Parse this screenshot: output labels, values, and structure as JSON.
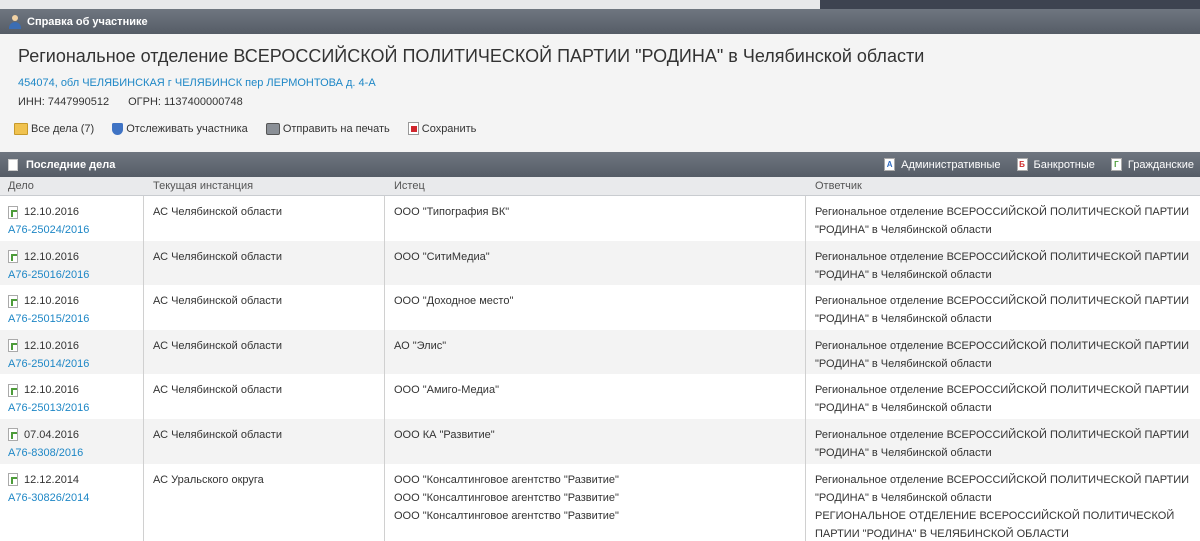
{
  "panel_title": "Справка об участнике",
  "organization": {
    "name": "Региональное отделение ВСЕРОССИЙСКОЙ ПОЛИТИЧЕСКОЙ ПАРТИИ \"РОДИНА\" в Челябинской области",
    "address": "454074, обл ЧЕЛЯБИНСКАЯ г ЧЕЛЯБИНСК пер ЛЕРМОНТОВА д. 4-А",
    "inn": "ИНН: 7447990512",
    "ogrn": "ОГРН: 1137400000748"
  },
  "actions": {
    "all_cases": "Все дела (7)",
    "track": "Отслеживать участника",
    "print": "Отправить на печать",
    "save": "Сохранить"
  },
  "cases_section": {
    "title": "Последние дела",
    "filters": [
      "Административные",
      "Банкротные",
      "Гражданские"
    ],
    "filter_letters": [
      "A",
      "Б",
      "Г"
    ]
  },
  "columns": [
    "Дело",
    "Текущая инстанция",
    "Истец",
    "Ответчик"
  ],
  "rows": [
    {
      "date": "12.10.2016",
      "case": "А76-25024/2016",
      "instance": "АС Челябинской области",
      "plaintiffs": [
        "ООО \"Типография ВК\""
      ],
      "defendants": [
        "Региональное отделение ВСЕРОССИЙСКОЙ ПОЛИТИЧЕСКОЙ ПАРТИИ",
        "\"РОДИНА\" в Челябинской области"
      ]
    },
    {
      "date": "12.10.2016",
      "case": "А76-25016/2016",
      "instance": "АС Челябинской области",
      "plaintiffs": [
        "ООО \"СитиМедиа\""
      ],
      "defendants": [
        "Региональное отделение ВСЕРОССИЙСКОЙ ПОЛИТИЧЕСКОЙ ПАРТИИ",
        "\"РОДИНА\" в Челябинской области"
      ]
    },
    {
      "date": "12.10.2016",
      "case": "А76-25015/2016",
      "instance": "АС Челябинской области",
      "plaintiffs": [
        "ООО \"Доходное место\""
      ],
      "defendants": [
        "Региональное отделение ВСЕРОССИЙСКОЙ ПОЛИТИЧЕСКОЙ ПАРТИИ",
        "\"РОДИНА\" в Челябинской области"
      ]
    },
    {
      "date": "12.10.2016",
      "case": "А76-25014/2016",
      "instance": "АС Челябинской области",
      "plaintiffs": [
        "АО \"Элис\""
      ],
      "defendants": [
        "Региональное отделение ВСЕРОССИЙСКОЙ ПОЛИТИЧЕСКОЙ ПАРТИИ",
        "\"РОДИНА\" в Челябинской области"
      ]
    },
    {
      "date": "12.10.2016",
      "case": "А76-25013/2016",
      "instance": "АС Челябинской области",
      "plaintiffs": [
        "ООО \"Амиго-Медиа\""
      ],
      "defendants": [
        "Региональное отделение ВСЕРОССИЙСКОЙ ПОЛИТИЧЕСКОЙ ПАРТИИ",
        "\"РОДИНА\" в Челябинской области"
      ]
    },
    {
      "date": "07.04.2016",
      "case": "А76-8308/2016",
      "instance": "АС Челябинской области",
      "plaintiffs": [
        "ООО КА \"Развитие\""
      ],
      "defendants": [
        "Региональное отделение ВСЕРОССИЙСКОЙ ПОЛИТИЧЕСКОЙ ПАРТИИ",
        "\"РОДИНА\" в Челябинской области"
      ]
    },
    {
      "date": "12.12.2014",
      "case": "А76-30826/2014",
      "instance": "АС Уральского округа",
      "plaintiffs": [
        "ООО \"Консалтинговое агентство \"Развитие\"",
        "ООО \"Консалтинговое агентство \"Развитие\"",
        "ООО \"Консалтинговое агентство \"Развитие\""
      ],
      "defendants": [
        "Региональное отделение ВСЕРОССИЙСКОЙ ПОЛИТИЧЕСКОЙ ПАРТИИ",
        "\"РОДИНА\" в Челябинской области",
        "РЕГИОНАЛЬНОЕ ОТДЕЛЕНИЕ ВСЕРОССИЙСКОЙ ПОЛИТИЧЕСКОЙ",
        "ПАРТИИ \"РОДИНА\" В ЧЕЛЯБИНСКОЙ ОБЛАСТИ"
      ]
    }
  ]
}
